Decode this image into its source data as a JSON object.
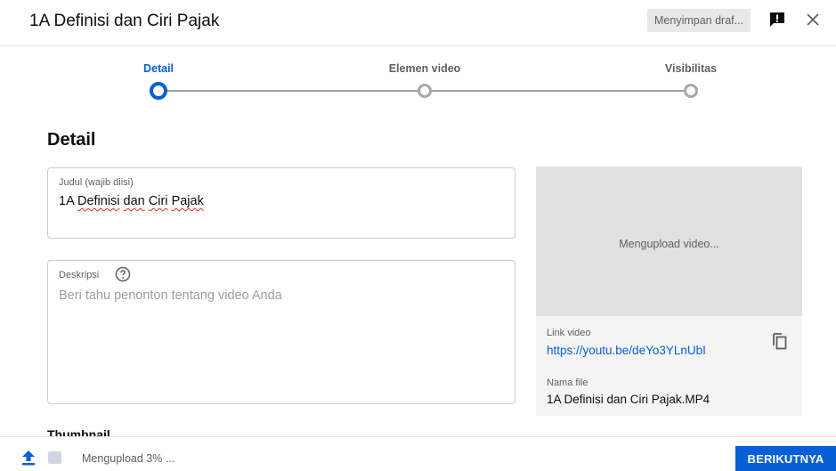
{
  "header": {
    "title": "1A Definisi dan Ciri Pajak",
    "draft_status": "Menyimpan draf..."
  },
  "stepper": {
    "steps": [
      {
        "label": "Detail",
        "active": true
      },
      {
        "label": "Elemen video",
        "active": false
      },
      {
        "label": "Visibilitas",
        "active": false
      }
    ]
  },
  "details": {
    "section_title": "Detail",
    "title_field": {
      "label": "Judul (wajib diisi)",
      "value_prefix": "1A ",
      "value_misspelled_1": "Definisi",
      "value_sep_1": " ",
      "value_misspelled_2": "dan",
      "value_sep_2": " ",
      "value_misspelled_3": "Ciri",
      "value_sep_3": " ",
      "value_misspelled_4": "Pajak"
    },
    "description_field": {
      "label": "Deskripsi",
      "placeholder": "Beri tahu penonton tentang video Anda"
    },
    "thumbnail_label": "Thumbnail"
  },
  "preview": {
    "status": "Mengupload video...",
    "link_label": "Link video",
    "link_url": "https://youtu.be/deYo3YLnUbI",
    "filename_label": "Nama file",
    "filename": "1A Definisi dan Ciri Pajak.MP4"
  },
  "footer": {
    "upload_status": "Mengupload 3% ...",
    "upload_progress_percent": 3,
    "next_label": "BERIKUTNYA"
  },
  "colors": {
    "accent": "#065fd4",
    "muted_text": "#606060",
    "step_inactive": "#a8a8a8"
  }
}
